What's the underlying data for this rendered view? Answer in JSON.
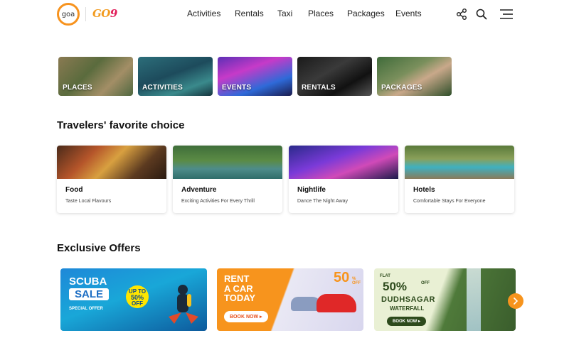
{
  "brand": {
    "logo_text": "goa",
    "wordmark_a": "GO",
    "wordmark_b": "9"
  },
  "nav": [
    "Activities",
    "Rentals",
    "Taxi",
    "Places",
    "Packages",
    "Events"
  ],
  "header_icons": [
    "share-icon",
    "search-icon",
    "menu-icon"
  ],
  "categories": [
    "PLACES",
    "ACTIVITIES",
    "EVENTS",
    "RENTALS",
    "PACKAGES"
  ],
  "favorites": {
    "title": "Travelers' favorite choice",
    "cards": [
      {
        "title": "Food",
        "subtitle": "Taste Local Flavours"
      },
      {
        "title": "Adventure",
        "subtitle": "Exciting Activities For Every Thrill"
      },
      {
        "title": "Nightlife",
        "subtitle": "Dance The Night Away"
      },
      {
        "title": "Hotels",
        "subtitle": "Comfortable Stays For Everyone"
      }
    ]
  },
  "offers": {
    "title": "Exclusive Offers",
    "scuba": {
      "line1": "SCUBA",
      "line2": "SALE",
      "special": "SPECIAL OFFER",
      "badge_top": "UP TO",
      "badge_pct": "50%",
      "badge_off": "OFF"
    },
    "car": {
      "title": "RENT\nA CAR\nTODAY",
      "button": "BOOK NOW",
      "pct": "50",
      "off": "% OFF"
    },
    "waterfall": {
      "flat": "FLAT",
      "pct": "50%",
      "off": "OFF",
      "name": "DUDHSAGAR",
      "sub": "WATERFALL",
      "button": "BOOK NOW"
    }
  },
  "colors": {
    "accent": "#f7941d",
    "text": "#111111"
  }
}
